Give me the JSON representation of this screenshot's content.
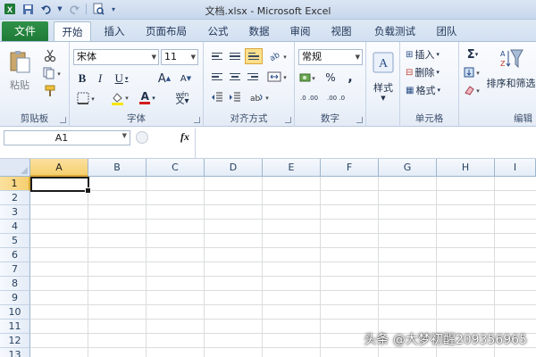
{
  "window": {
    "title": "文档.xlsx - Microsoft Excel"
  },
  "quick_access": {
    "icons": [
      "excel-logo-icon",
      "save-icon",
      "undo-icon",
      "redo-icon",
      "print-preview-icon",
      "customize-qat-icon"
    ]
  },
  "tabs": {
    "file": "文件",
    "home": "开始",
    "insert": "插入",
    "page_layout": "页面布局",
    "formulas": "公式",
    "data": "数据",
    "review": "审阅",
    "view": "视图",
    "load_test": "负载测试",
    "team": "团队"
  },
  "ribbon": {
    "clipboard": {
      "label": "剪贴板",
      "paste": "粘贴"
    },
    "font": {
      "label": "字体",
      "font_name": "宋体",
      "font_size": "11",
      "bold": "B",
      "italic": "I",
      "underline": "U",
      "font_color_glyph": "A",
      "grow": "A",
      "shrink": "A",
      "phonetic": "wén"
    },
    "alignment": {
      "label": "对齐方式"
    },
    "number": {
      "label": "数字",
      "format": "常规",
      "percent": "%",
      "comma": ",",
      "inc_decimal": ".0 .00",
      "dec_decimal": ".00 .0"
    },
    "styles": {
      "label": "样式"
    },
    "cells": {
      "label": "单元格",
      "insert": "插入",
      "delete": "删除",
      "format": "格式"
    },
    "editing": {
      "label": "编辑",
      "sum": "Σ",
      "sort_filter": "排序和筛选"
    }
  },
  "formula_bar": {
    "name_box": "A1",
    "fx": "fx",
    "formula": ""
  },
  "grid": {
    "columns": [
      "A",
      "B",
      "C",
      "D",
      "E",
      "F",
      "G",
      "H",
      "I"
    ],
    "rows": [
      "1",
      "2",
      "3",
      "4",
      "5",
      "6",
      "7",
      "8",
      "9",
      "10",
      "11",
      "12",
      "13"
    ],
    "selected_cell": "A1"
  },
  "watermark": "头条 @大梦初醒209356965",
  "colors": {
    "file_tab": "#1e7a37",
    "selected_header": "#f6cf6f",
    "gridline": "#dadcdd",
    "ribbon_bg": "#eef3fa"
  }
}
